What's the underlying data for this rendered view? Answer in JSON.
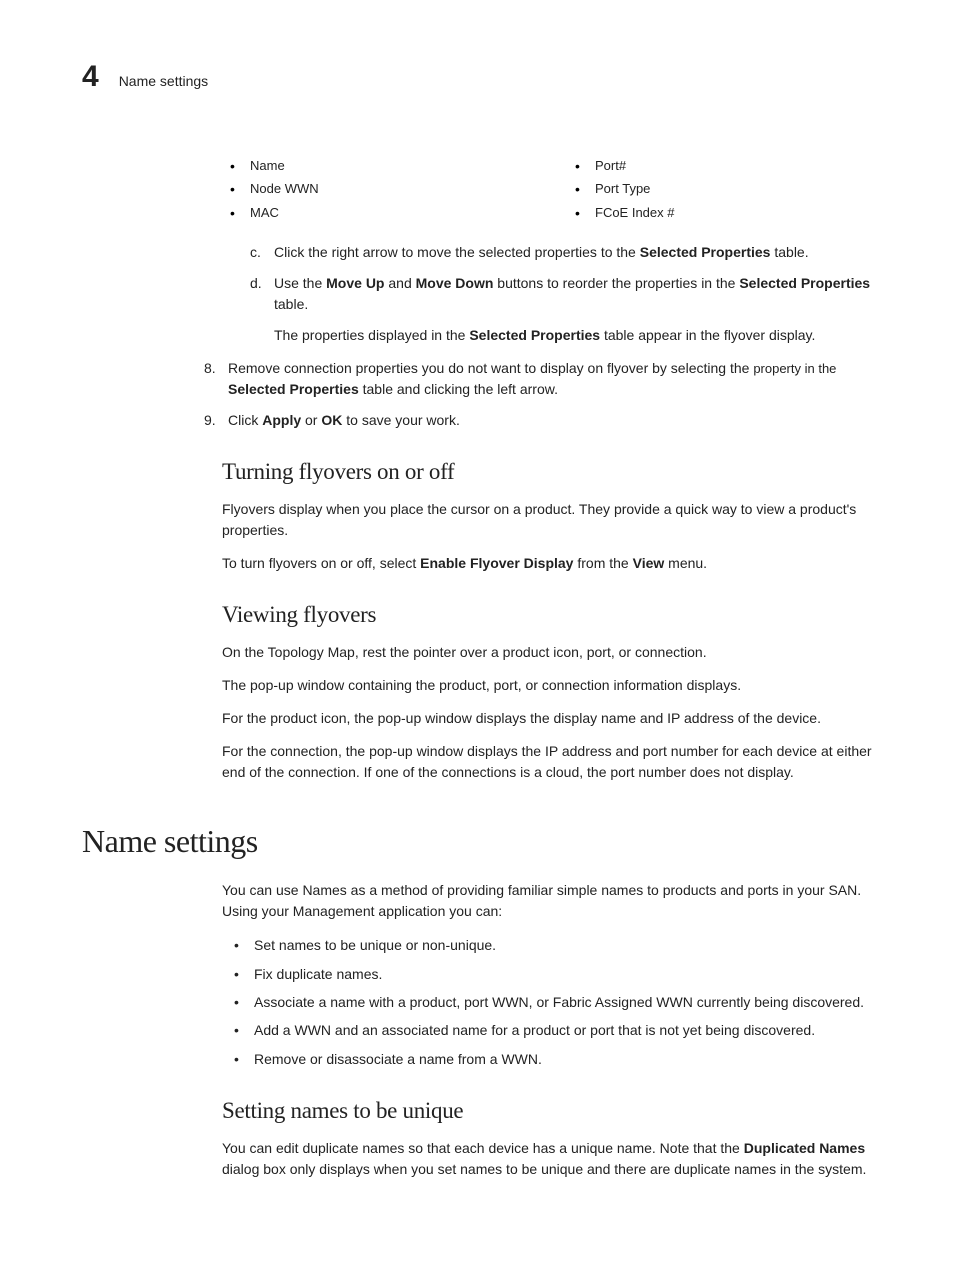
{
  "header": {
    "chapter_number": "4",
    "title": "Name settings"
  },
  "bullets_left": [
    "Name",
    "Node WWN",
    "MAC"
  ],
  "bullets_right": [
    "Port#",
    "Port Type",
    "FCoE Index #"
  ],
  "steps_lettered": {
    "c": {
      "marker": "c.",
      "pre": "Click the right arrow to move the selected properties to the ",
      "bold1": "Selected Properties",
      "post": " table."
    },
    "d": {
      "marker": "d.",
      "t1": "Use the ",
      "b1": "Move Up",
      "t2": " and ",
      "b2": "Move Down",
      "t3": " buttons to reorder the properties in the ",
      "b3": "Selected Properties",
      "t4": " table.",
      "note_t1": "The properties displayed in the ",
      "note_b1": "Selected Properties",
      "note_t2": " table appear in the flyover display."
    }
  },
  "steps_num": {
    "s8": {
      "marker": "8.",
      "t1": "Remove connection properties you do not want to display on flyover by selecting the ",
      "small1": "property in the ",
      "b1": "Selected Properties",
      "t2": " table and clicking the left arrow."
    },
    "s9": {
      "marker": "9.",
      "t1": "Click ",
      "b1": "Apply",
      "t2": " or ",
      "b2": "OK",
      "t3": " to save your work."
    }
  },
  "turning": {
    "heading": "Turning flyovers on or off",
    "p1": "Flyovers display when you place the cursor on a product. They provide a quick way to view a product's properties.",
    "p2_t1": "To turn flyovers on or off, select ",
    "p2_b1": "Enable Flyover Display",
    "p2_t2": " from the ",
    "p2_b2": "View",
    "p2_t3": " menu."
  },
  "viewing": {
    "heading": "Viewing flyovers",
    "p1": "On the Topology Map, rest the pointer over a product icon, port, or connection.",
    "p2": "The pop-up window containing the product, port, or connection information displays.",
    "p3": "For the product icon, the pop-up window displays the display name and IP address of the device.",
    "p4": "For the connection, the pop-up window displays the IP address and port number for each device at either end of the connection. If one of the connections is a cloud, the port number does not display."
  },
  "name_settings": {
    "heading": "Name settings",
    "intro": "You can use Names as a method of providing familiar simple names to products and ports in your SAN. Using your Management application you can:",
    "bullets": [
      "Set names to be unique or non-unique.",
      "Fix duplicate names.",
      "Associate a name with a product, port WWN, or Fabric Assigned WWN currently being discovered.",
      "Add a WWN and an associated name for a product or port that is not yet being discovered.",
      "Remove or disassociate a name from a WWN."
    ]
  },
  "unique": {
    "heading": "Setting names to be unique",
    "p1_t1": "You can edit duplicate names so that each device has a unique name. Note that the ",
    "p1_b1": "Duplicated Names",
    "p1_t2": " dialog box only displays when you set names to be unique and there are duplicate names in the system."
  }
}
